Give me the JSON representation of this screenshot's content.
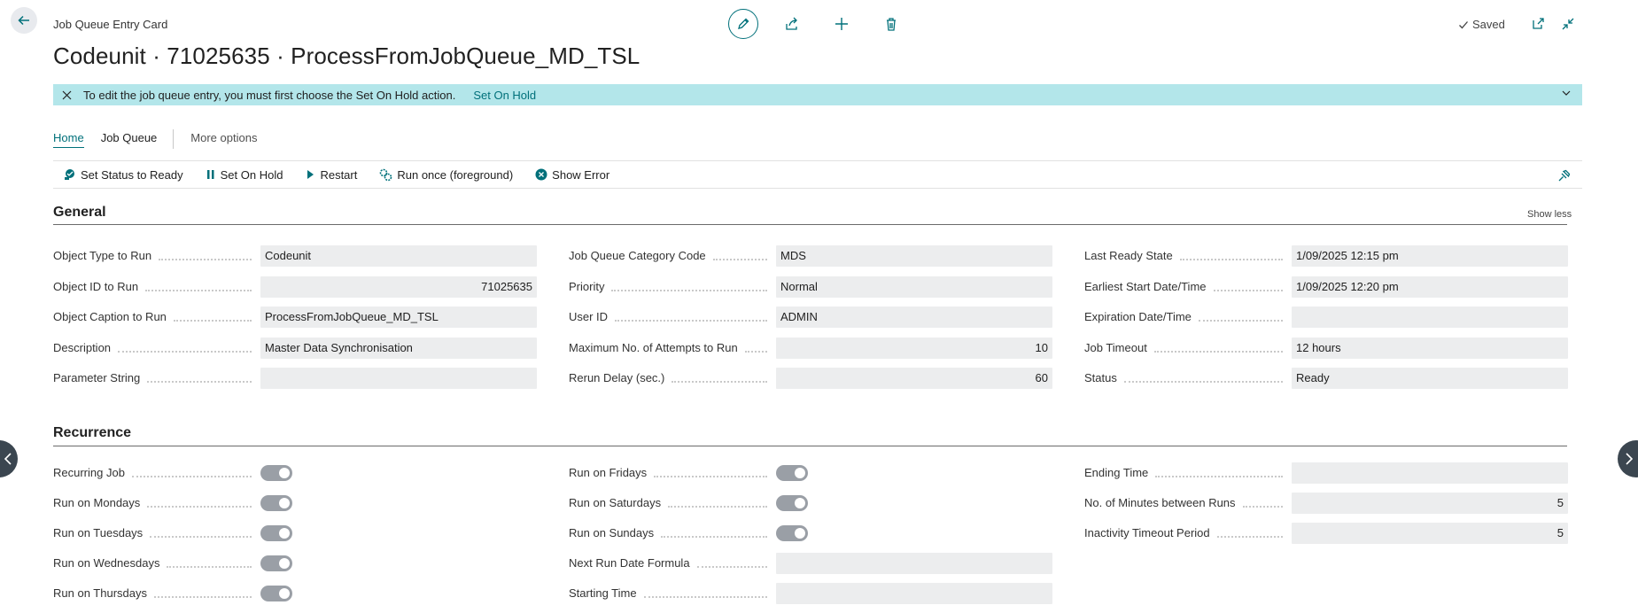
{
  "header": {
    "caption": "Job Queue Entry Card",
    "title": "Codeunit · 71025635 · ProcessFromJobQueue_MD_TSL",
    "saved_label": "Saved"
  },
  "banner": {
    "message": "To edit the job queue entry, you must first choose the Set On Hold action.",
    "link": "Set On Hold"
  },
  "tabs": [
    {
      "label": "Home",
      "active": true
    },
    {
      "label": "Job Queue",
      "active": false
    },
    {
      "label": "More options",
      "active": false
    }
  ],
  "actions": [
    {
      "label": "Set Status to Ready",
      "icon": "status-ready-icon"
    },
    {
      "label": "Set On Hold",
      "icon": "pause-icon"
    },
    {
      "label": "Restart",
      "icon": "play-icon"
    },
    {
      "label": "Run once (foreground)",
      "icon": "run-once-icon"
    },
    {
      "label": "Show Error",
      "icon": "error-icon"
    }
  ],
  "general": {
    "title": "General",
    "show_less": "Show less",
    "col1": [
      {
        "label": "Object Type to Run",
        "value": "Codeunit",
        "align": "left"
      },
      {
        "label": "Object ID to Run",
        "value": "71025635",
        "align": "right"
      },
      {
        "label": "Object Caption to Run",
        "value": "ProcessFromJobQueue_MD_TSL",
        "align": "left"
      },
      {
        "label": "Description",
        "value": "Master Data Synchronisation",
        "align": "left"
      },
      {
        "label": "Parameter String",
        "value": "",
        "align": "left"
      }
    ],
    "col2": [
      {
        "label": "Job Queue Category Code",
        "value": "MDS",
        "align": "left"
      },
      {
        "label": "Priority",
        "value": "Normal",
        "align": "left"
      },
      {
        "label": "User ID",
        "value": "ADMIN",
        "align": "left"
      },
      {
        "label": "Maximum No. of Attempts to Run",
        "value": "10",
        "align": "right"
      },
      {
        "label": "Rerun Delay (sec.)",
        "value": "60",
        "align": "right"
      }
    ],
    "col3": [
      {
        "label": "Last Ready State",
        "value": "1/09/2025 12:15 pm",
        "align": "left"
      },
      {
        "label": "Earliest Start Date/Time",
        "value": "1/09/2025 12:20 pm",
        "align": "left"
      },
      {
        "label": "Expiration Date/Time",
        "value": "",
        "align": "left"
      },
      {
        "label": "Job Timeout",
        "value": "12 hours",
        "align": "left"
      },
      {
        "label": "Status",
        "value": "Ready",
        "align": "left"
      }
    ]
  },
  "recurrence": {
    "title": "Recurrence",
    "col1": [
      {
        "label": "Recurring Job",
        "toggle": true
      },
      {
        "label": "Run on Mondays",
        "toggle": true
      },
      {
        "label": "Run on Tuesdays",
        "toggle": true
      },
      {
        "label": "Run on Wednesdays",
        "toggle": true
      },
      {
        "label": "Run on Thursdays",
        "toggle": true
      }
    ],
    "col2": [
      {
        "label": "Run on Fridays",
        "toggle": true
      },
      {
        "label": "Run on Saturdays",
        "toggle": true
      },
      {
        "label": "Run on Sundays",
        "toggle": true
      },
      {
        "label": "Next Run Date Formula",
        "value": ""
      },
      {
        "label": "Starting Time",
        "value": ""
      }
    ],
    "col3": [
      {
        "label": "Ending Time",
        "value": "",
        "align": "left"
      },
      {
        "label": "No. of Minutes between Runs",
        "value": "5",
        "align": "right"
      },
      {
        "label": "Inactivity Timeout Period",
        "value": "5",
        "align": "right"
      }
    ]
  },
  "colors": {
    "accent": "#00707a",
    "banner": "#b3e6ea",
    "field_bg": "#ecedee",
    "toggle_bg": "#9a9fa6"
  }
}
